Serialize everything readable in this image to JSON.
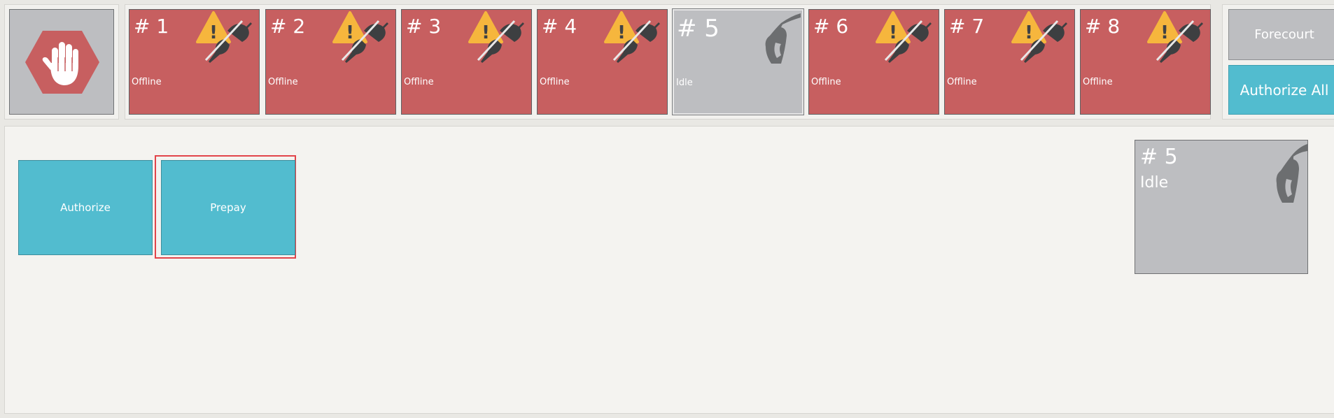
{
  "pumps": [
    {
      "label": "# 1",
      "status": "Offline"
    },
    {
      "label": "# 2",
      "status": "Offline"
    },
    {
      "label": "# 3",
      "status": "Offline"
    },
    {
      "label": "# 4",
      "status": "Offline"
    },
    {
      "label": "# 5",
      "status": "Idle"
    },
    {
      "label": "# 6",
      "status": "Offline"
    },
    {
      "label": "# 7",
      "status": "Offline"
    },
    {
      "label": "# 8",
      "status": "Offline"
    }
  ],
  "right_buttons": {
    "forecourt": "Forecourt",
    "authorize_all": "Authorize All"
  },
  "actions": {
    "authorize": "Authorize",
    "prepay": "Prepay"
  },
  "selected_pump": {
    "label": "# 5",
    "status": "Idle"
  },
  "icons": {
    "stop": "hand-stop-icon",
    "offline": "warning-unplugged-icon",
    "idle": "fuel-nozzle-icon"
  },
  "colors": {
    "offline": "#c75f60",
    "idle": "#bdbec1",
    "accent": "#52bccf",
    "selection": "#e2444a",
    "warning": "#f6b63d"
  }
}
